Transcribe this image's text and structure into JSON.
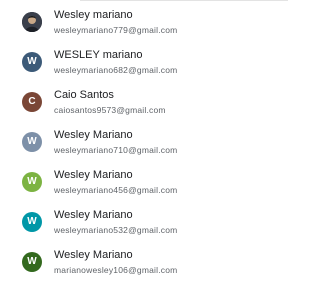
{
  "accounts": [
    {
      "name": "Wesley mariano",
      "email": "wesleymariano779@gmail.com",
      "avatar": "photo",
      "initial": "",
      "color": "#2b2f3a"
    },
    {
      "name": "WESLEY mariano",
      "email": "wesleymariano682@gmail.com",
      "avatar": "letter",
      "initial": "W",
      "color": "#3c5a78"
    },
    {
      "name": "Caio Santos",
      "email": "caiosantos9573@gmail.com",
      "avatar": "letter",
      "initial": "C",
      "color": "#7a4636"
    },
    {
      "name": "Wesley Mariano",
      "email": "wesleymariano710@gmail.com",
      "avatar": "letter",
      "initial": "W",
      "color": "#7d90a8"
    },
    {
      "name": "Wesley Mariano",
      "email": "wesleymariano456@gmail.com",
      "avatar": "letter",
      "initial": "W",
      "color": "#7cb342"
    },
    {
      "name": "Wesley Mariano",
      "email": "wesleymariano532@gmail.com",
      "avatar": "letter",
      "initial": "W",
      "color": "#0097a7"
    },
    {
      "name": "Wesley Mariano",
      "email": "marianowesley106@gmail.com",
      "avatar": "letter",
      "initial": "W",
      "color": "#33691e"
    }
  ]
}
